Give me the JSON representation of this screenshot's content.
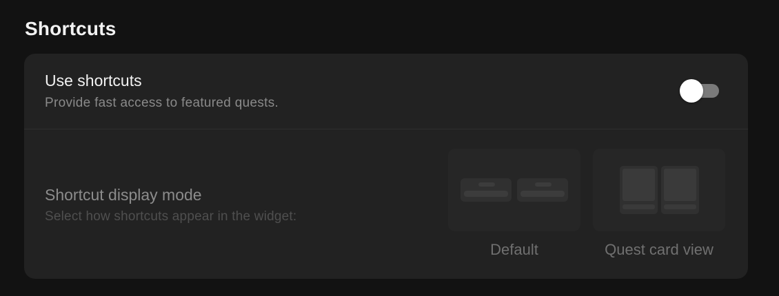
{
  "section": {
    "title": "Shortcuts"
  },
  "use_shortcuts": {
    "title": "Use shortcuts",
    "description": "Provide fast access to featured quests.",
    "enabled": false
  },
  "display_mode": {
    "title": "Shortcut display mode",
    "description": "Select how shortcuts appear in the widget:",
    "options": [
      {
        "label": "Default",
        "preview": "two-horizontal-pills-icon"
      },
      {
        "label": "Quest card view",
        "preview": "two-cards-icon"
      }
    ],
    "disabled": true
  },
  "colors": {
    "background": "#121212",
    "card": "#222222",
    "toggle_track": "#7a7a7a",
    "toggle_knob": "#ffffff"
  }
}
